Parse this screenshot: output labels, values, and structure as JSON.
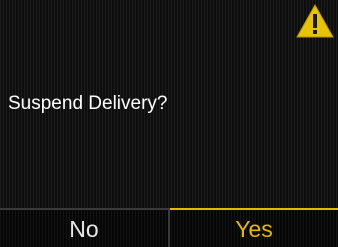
{
  "dialog": {
    "prompt": "Suspend Delivery?",
    "icon": "warning-icon"
  },
  "softkeys": {
    "left_label": "No",
    "right_label": "Yes"
  },
  "colors": {
    "accent": "#e6b800",
    "text": "#ffffff",
    "warning": "#f0c800"
  }
}
